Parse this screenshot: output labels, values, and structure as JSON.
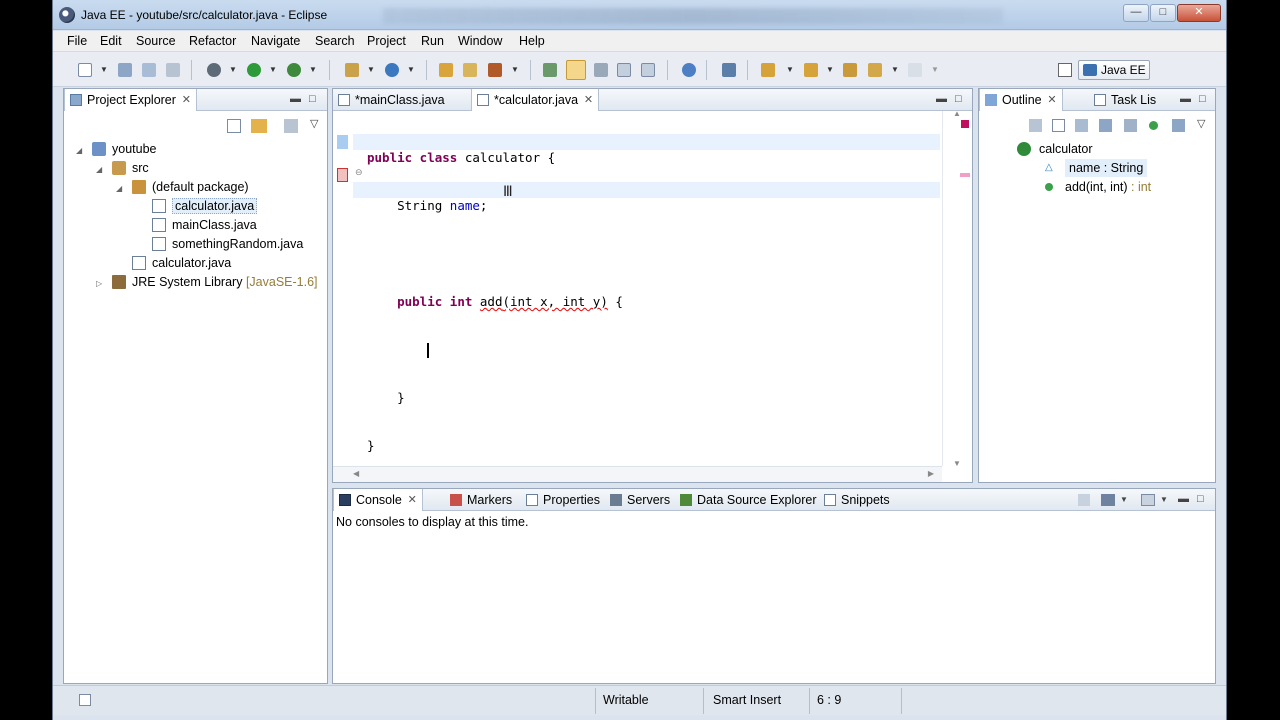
{
  "window": {
    "title": "Java EE - youtube/src/calculator.java - Eclipse"
  },
  "menubar": {
    "items": [
      "File",
      "Edit",
      "Source",
      "Refactor",
      "Navigate",
      "Search",
      "Project",
      "Run",
      "Window",
      "Help"
    ]
  },
  "toolbar": {
    "perspective_label": "Java EE"
  },
  "project_explorer": {
    "tab_label": "Project Explorer",
    "tree": [
      {
        "label": "youtube",
        "icon": "project-icon"
      },
      {
        "label": "src",
        "icon": "source-folder-icon"
      },
      {
        "label": "(default package)",
        "icon": "package-icon"
      },
      {
        "label": "calculator.java",
        "icon": "java-file-icon",
        "selected": true
      },
      {
        "label": "mainClass.java",
        "icon": "java-file-icon"
      },
      {
        "label": "somethingRandom.java",
        "icon": "java-file-icon"
      },
      {
        "label": "calculator.java",
        "icon": "java-file-icon"
      },
      {
        "label": "JRE System Library",
        "suffix": "[JavaSE-1.6]",
        "icon": "library-icon"
      }
    ]
  },
  "editor": {
    "tabs": [
      {
        "label": "*mainClass.java",
        "active": false
      },
      {
        "label": "*calculator.java",
        "active": true
      }
    ],
    "code": {
      "l1_kw": "public class",
      "l1_rest": " calculator {",
      "l2_type": "String",
      "l2_field": "name",
      "l2_end": ";",
      "l3_kw": "public int",
      "l3_method": "add",
      "l3_params": "(int x, int y)",
      "l3_end": " {",
      "l5": "}",
      "l6": "}"
    }
  },
  "outline": {
    "tabs": [
      {
        "label": "Outline",
        "active": true
      },
      {
        "label": "Task Lis",
        "active": false
      }
    ],
    "items": {
      "class_name": "calculator",
      "field_label": "name : String",
      "method_name": "add(int, int)",
      "method_ret": " : int"
    }
  },
  "bottom_panel": {
    "tabs": [
      "Console",
      "Markers",
      "Properties",
      "Servers",
      "Data Source Explorer",
      "Snippets"
    ],
    "message": "No consoles to display at this time."
  },
  "statusbar": {
    "mode": "Writable",
    "insert": "Smart Insert",
    "position": "6 : 9"
  },
  "colors": {
    "keyword": "#7f0055",
    "field": "#0000c0",
    "error": "#e00000",
    "return_type": "#957c3a"
  }
}
